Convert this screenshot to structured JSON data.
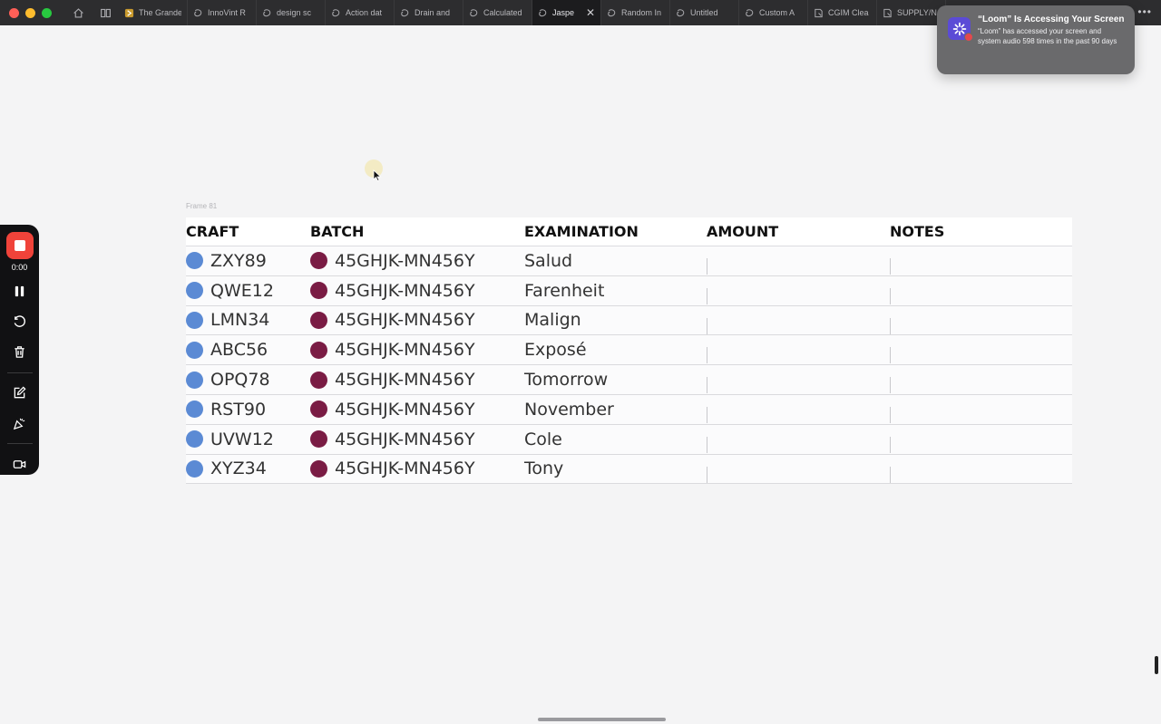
{
  "browser": {
    "tabs": [
      {
        "label": "The Grande",
        "icon": "app-icon",
        "active": false
      },
      {
        "label": "InnoVint R",
        "icon": "copilot-icon",
        "active": false
      },
      {
        "label": "design sc",
        "icon": "copilot-icon",
        "active": false
      },
      {
        "label": "Action dat",
        "icon": "copilot-icon",
        "active": false
      },
      {
        "label": "Drain and",
        "icon": "copilot-icon",
        "active": false
      },
      {
        "label": "Calculated",
        "icon": "copilot-icon",
        "active": false
      },
      {
        "label": "Jaspe",
        "icon": "copilot-icon",
        "active": true
      },
      {
        "label": "Random In",
        "icon": "copilot-icon",
        "active": false
      },
      {
        "label": "Untitled",
        "icon": "copilot-icon",
        "active": false
      },
      {
        "label": "Custom A",
        "icon": "copilot-icon",
        "active": false
      },
      {
        "label": "CGIM Clea",
        "icon": "doc-icon",
        "active": false
      },
      {
        "label": "SUPPLY/N",
        "icon": "doc-icon",
        "active": false
      }
    ],
    "more_label": "•••"
  },
  "notification": {
    "title": "“Loom” Is Accessing Your Screen",
    "body": "“Loom” has accessed your screen and system audio 598 times in the past 90 days"
  },
  "recorder": {
    "time": "0:00"
  },
  "canvas": {
    "frame_label": "Frame 81"
  },
  "table": {
    "headers": [
      "CRAFT",
      "BATCH",
      "EXAMINATION",
      "AMOUNT",
      "NOTES"
    ],
    "rows": [
      {
        "craft": "ZXY89",
        "batch": "45GHJK-MN456Y",
        "examination": "Salud",
        "amount": "",
        "notes": ""
      },
      {
        "craft": "QWE12",
        "batch": "45GHJK-MN456Y",
        "examination": "Farenheit",
        "amount": "",
        "notes": ""
      },
      {
        "craft": "LMN34",
        "batch": "45GHJK-MN456Y",
        "examination": "Malign",
        "amount": "",
        "notes": ""
      },
      {
        "craft": "ABC56",
        "batch": "45GHJK-MN456Y",
        "examination": "Exposé",
        "amount": "",
        "notes": ""
      },
      {
        "craft": "OPQ78",
        "batch": "45GHJK-MN456Y",
        "examination": "Tomorrow",
        "amount": "",
        "notes": ""
      },
      {
        "craft": "RST90",
        "batch": "45GHJK-MN456Y",
        "examination": "November",
        "amount": "",
        "notes": ""
      },
      {
        "craft": "UVW12",
        "batch": "45GHJK-MN456Y",
        "examination": "Cole",
        "amount": "",
        "notes": ""
      },
      {
        "craft": "XYZ34",
        "batch": "45GHJK-MN456Y",
        "examination": "Tony",
        "amount": "",
        "notes": ""
      }
    ]
  },
  "colors": {
    "craft_bullet": "#5b8ad4",
    "batch_bullet": "#7a1c44",
    "record_red": "#f0433a"
  }
}
